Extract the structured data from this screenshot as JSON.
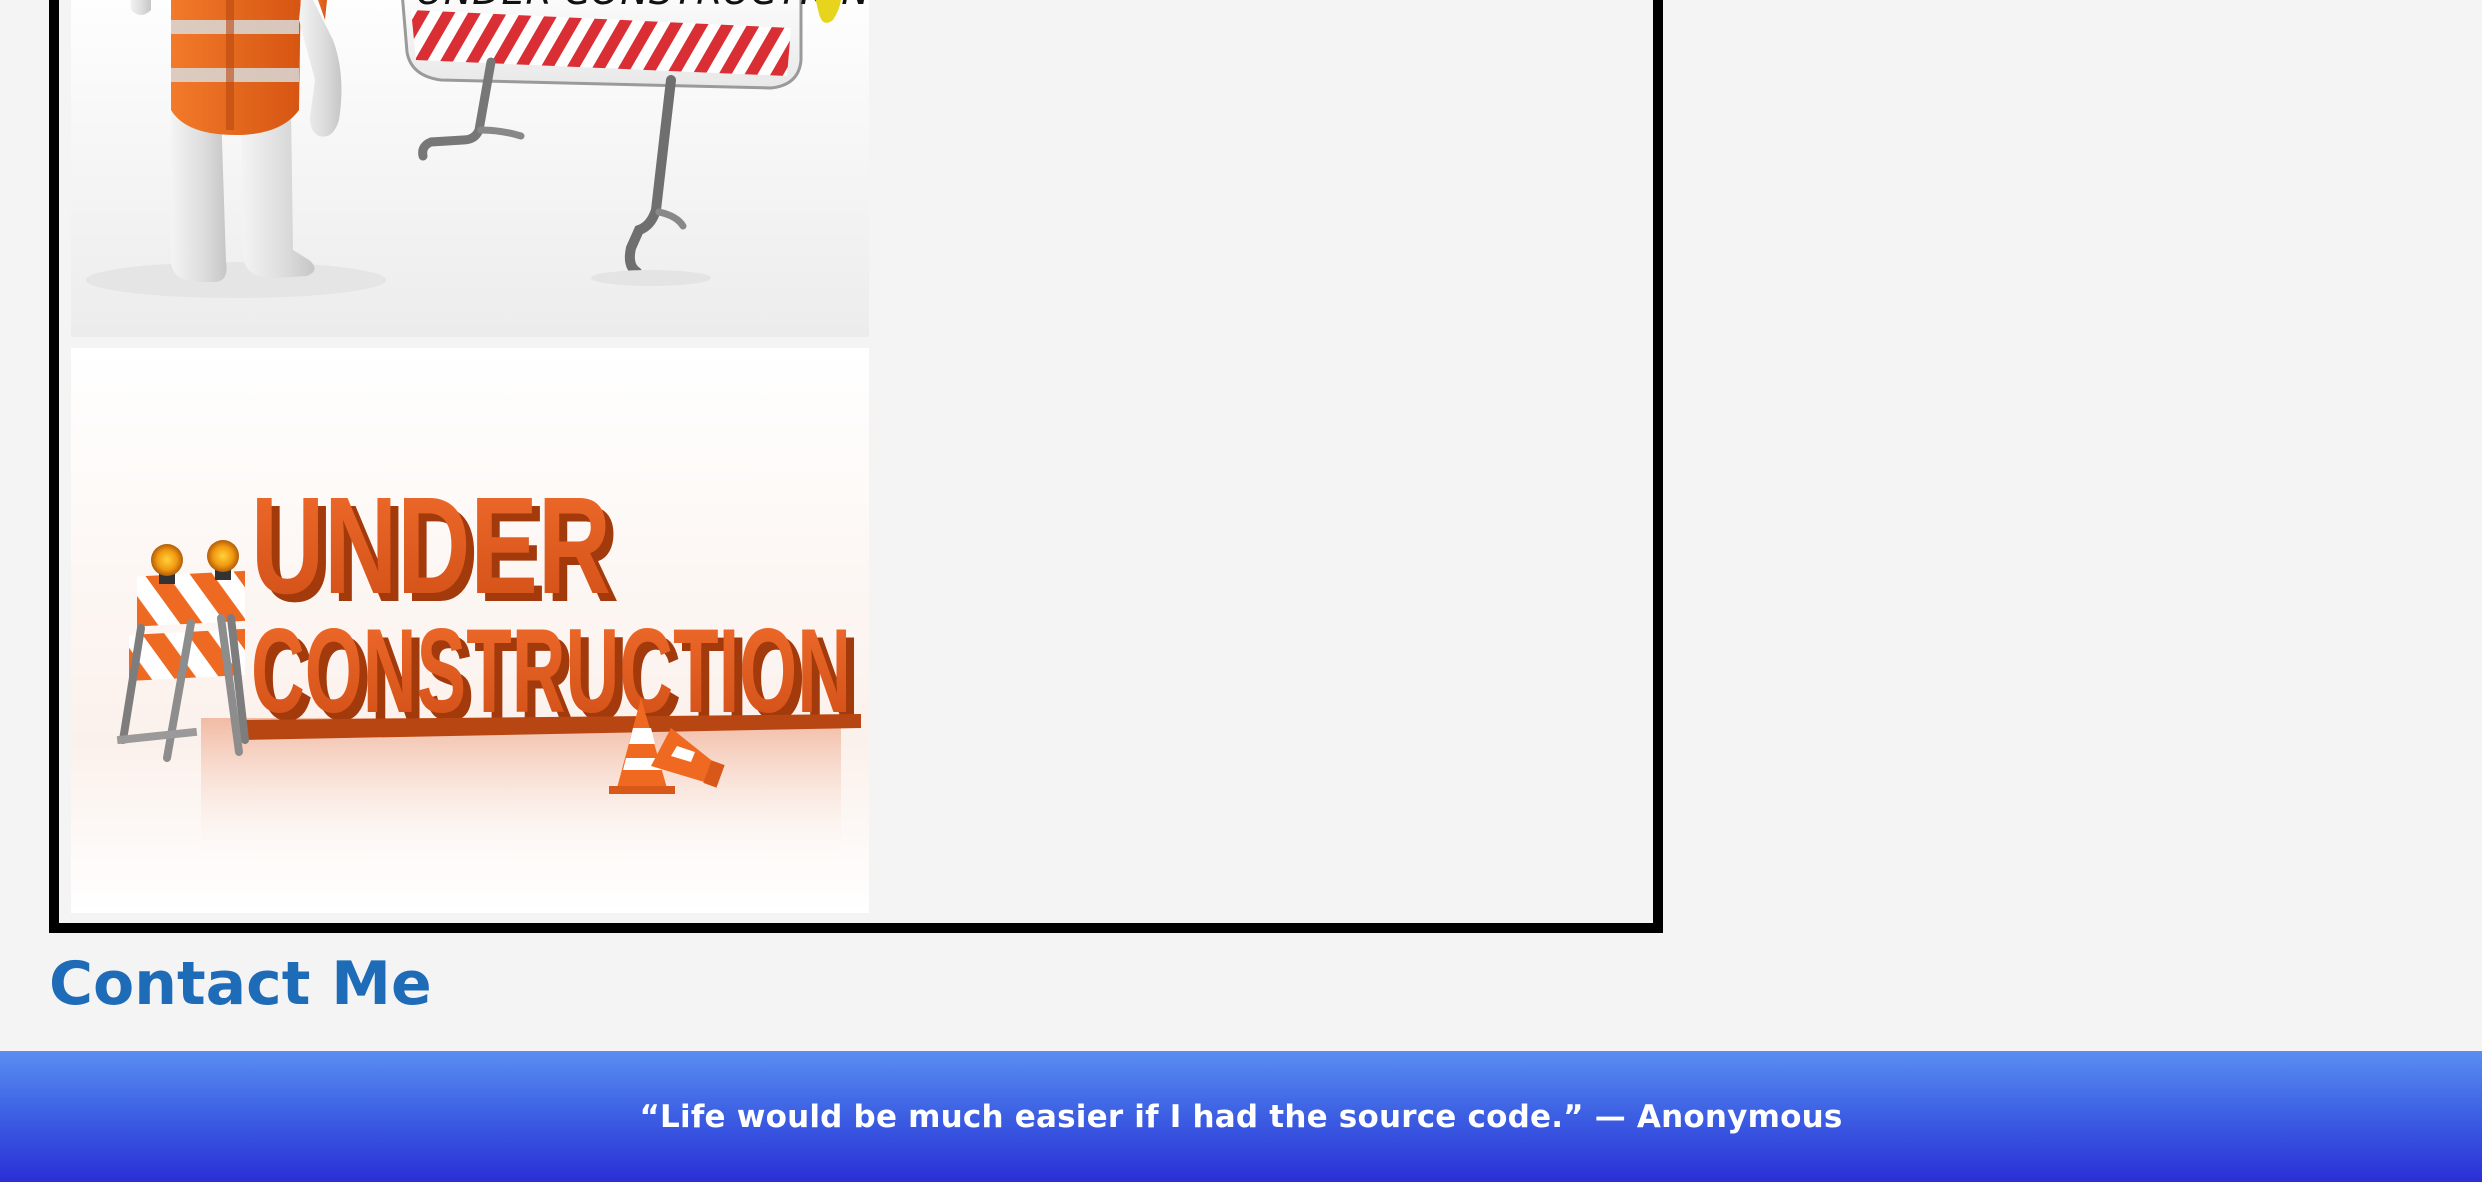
{
  "gallery": {
    "images": [
      {
        "name": "under-construction-sign-worker-image",
        "sign_text": "UNDER CONSTRUCTION"
      },
      {
        "name": "under-construction-3d-text-image",
        "line1": "UNDER",
        "line2": "CONSTRUCTION"
      }
    ]
  },
  "contact": {
    "heading": "Contact Me"
  },
  "footer": {
    "quote": "“Life would be much easier if I had the source code.” — Anonymous"
  },
  "colors": {
    "heading": "#1e6bb8",
    "footer_top": "#5a8ef2",
    "footer_bottom": "#2a2fd6",
    "frame_border": "#000000",
    "page_bg": "#f4f4f4"
  }
}
